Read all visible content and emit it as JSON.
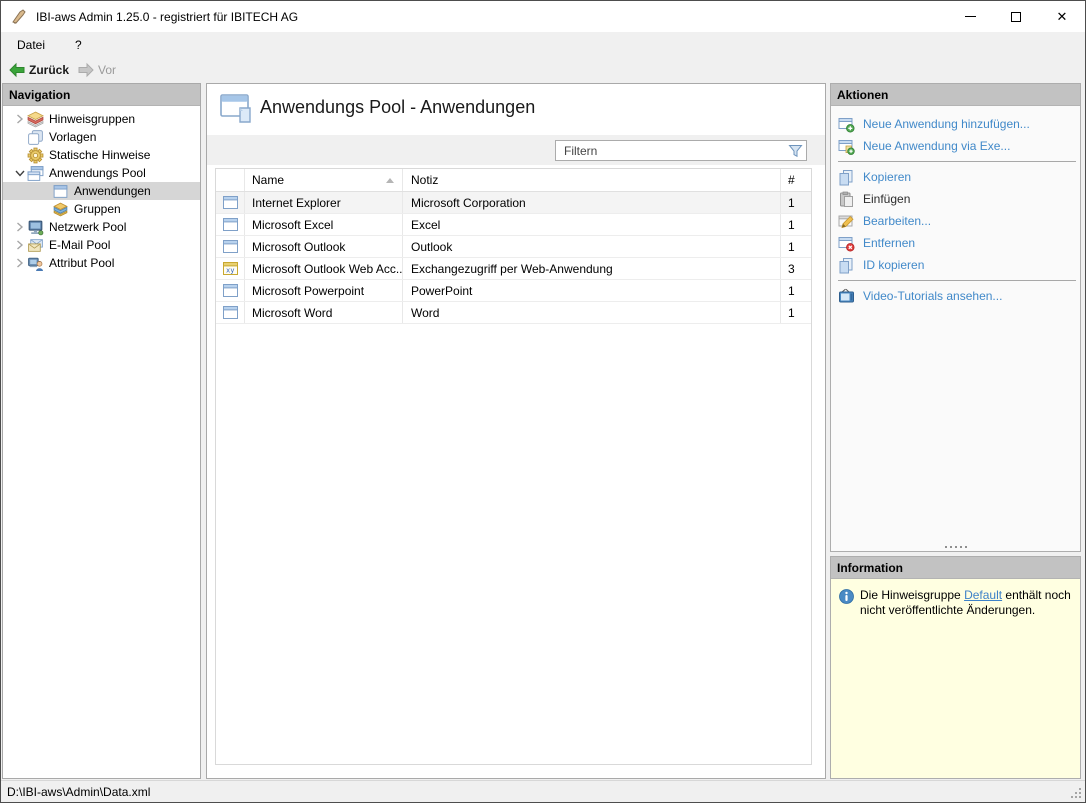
{
  "window": {
    "title": "IBI-aws Admin 1.25.0 - registriert für IBITECH AG",
    "controls": {
      "minimize": "minimize-icon",
      "maximize": "maximize-icon",
      "close": "close-icon"
    }
  },
  "menu": {
    "items": [
      {
        "label": "Datei"
      },
      {
        "label": "?"
      }
    ]
  },
  "toolbar": {
    "back_label": "Zurück",
    "forward_label": "Vor"
  },
  "navigation": {
    "header": "Navigation",
    "items": [
      {
        "label": "Hinweisgruppen",
        "icon": "notice-groups-icon",
        "expander": "collapsed",
        "level": 0,
        "selected": false
      },
      {
        "label": "Vorlagen",
        "icon": "templates-icon",
        "expander": "none",
        "level": 0,
        "selected": false
      },
      {
        "label": "Statische Hinweise",
        "icon": "static-notes-icon",
        "expander": "none",
        "level": 0,
        "selected": false
      },
      {
        "label": "Anwendungs Pool",
        "icon": "app-pool-icon",
        "expander": "expanded",
        "level": 0,
        "selected": false
      },
      {
        "label": "Anwendungen",
        "icon": "application-icon",
        "expander": "none",
        "level": 1,
        "selected": true
      },
      {
        "label": "Gruppen",
        "icon": "groups-icon",
        "expander": "none",
        "level": 1,
        "selected": false
      },
      {
        "label": "Netzwerk Pool",
        "icon": "network-pool-icon",
        "expander": "collapsed",
        "level": 0,
        "selected": false
      },
      {
        "label": "E-Mail Pool",
        "icon": "email-pool-icon",
        "expander": "collapsed",
        "level": 0,
        "selected": false
      },
      {
        "label": "Attribut Pool",
        "icon": "attribute-pool-icon",
        "expander": "collapsed",
        "level": 0,
        "selected": false
      }
    ]
  },
  "main": {
    "title": "Anwendungs Pool - Anwendungen",
    "filter": {
      "placeholder": "Filtern",
      "icon": "filter-funnel-icon"
    },
    "table": {
      "columns": [
        "",
        "Name",
        "Notiz",
        "#"
      ],
      "sort_column": "Name",
      "sort_direction": "asc",
      "rows": [
        {
          "icon": "window-icon",
          "name": "Internet Explorer",
          "notiz": "Microsoft Corporation",
          "count": "1"
        },
        {
          "icon": "window-icon",
          "name": "Microsoft Excel",
          "notiz": "Excel",
          "count": "1"
        },
        {
          "icon": "window-icon",
          "name": "Microsoft Outlook",
          "notiz": "Outlook",
          "count": "1"
        },
        {
          "icon": "webapp-icon",
          "name": "Microsoft Outlook Web Acc...",
          "notiz": "Exchangezugriff per Web-Anwendung",
          "count": "3"
        },
        {
          "icon": "window-icon",
          "name": "Microsoft Powerpoint",
          "notiz": "PowerPoint",
          "count": "1"
        },
        {
          "icon": "window-icon",
          "name": "Microsoft Word",
          "notiz": "Word",
          "count": "1"
        }
      ]
    }
  },
  "actions": {
    "header": "Aktionen",
    "items": [
      {
        "label": "Neue Anwendung hinzufügen...",
        "icon": "add-application-icon",
        "enabled": true
      },
      {
        "label": "Neue Anwendung via Exe...",
        "icon": "add-application-exe-icon",
        "enabled": true
      },
      {
        "label": "Kopieren",
        "icon": "copy-icon",
        "enabled": true
      },
      {
        "label": "Einfügen",
        "icon": "paste-icon",
        "enabled": false
      },
      {
        "label": "Bearbeiten...",
        "icon": "edit-icon",
        "enabled": true
      },
      {
        "label": "Entfernen",
        "icon": "remove-icon",
        "enabled": true
      },
      {
        "label": "ID kopieren",
        "icon": "copy-id-icon",
        "enabled": true
      },
      {
        "label": "Video-Tutorials ansehen...",
        "icon": "video-tutorial-icon",
        "enabled": true
      }
    ]
  },
  "information": {
    "header": "Information",
    "icon": "info-icon",
    "text_before": "Die Hinweisgruppe ",
    "link_label": "Default",
    "text_after": " enthält noch nicht veröffentlichte Änderungen."
  },
  "statusbar": {
    "path": "D:\\IBI-aws\\Admin\\Data.xml"
  },
  "colors": {
    "link_blue": "#4189c9",
    "info_background": "#ffffe1",
    "panel_header_gray": "#c2c2c2",
    "back_arrow_green": "#3aa53a",
    "forward_arrow_gray": "#c0c0c0",
    "selection_gray": "#d6d6d6"
  }
}
